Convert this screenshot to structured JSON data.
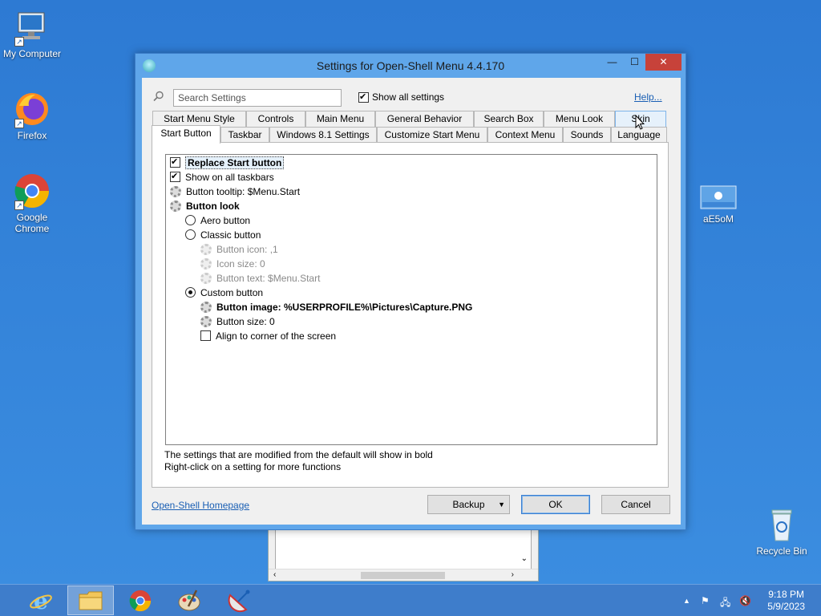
{
  "desktop": {
    "icons": [
      {
        "label": "My Computer"
      },
      {
        "label": "Firefox"
      },
      {
        "label": "Google Chrome"
      },
      {
        "label": "aE5oM"
      },
      {
        "label": "Recycle Bin"
      }
    ]
  },
  "window": {
    "title": "Settings for Open-Shell Menu 4.4.170",
    "search_placeholder": "Search Settings",
    "show_all_label": "Show all settings",
    "help_label": "Help...",
    "tabs_row1": [
      "Start Menu Style",
      "Controls",
      "Main Menu",
      "General Behavior",
      "Search Box",
      "Menu Look",
      "Skin"
    ],
    "tabs_row2": [
      "Start Button",
      "Taskbar",
      "Windows 8.1 Settings",
      "Customize Start Menu",
      "Context Menu",
      "Sounds",
      "Language"
    ],
    "active_tab": "Start Button",
    "settings": [
      {
        "label": "Replace Start button",
        "kind": "checkbox",
        "checked": true,
        "bold": true
      },
      {
        "label": "Show on all taskbars",
        "kind": "checkbox",
        "checked": true
      },
      {
        "label": "Button tooltip: $Menu.Start",
        "kind": "gear"
      },
      {
        "label": "Button look",
        "kind": "gear",
        "bold": true
      },
      {
        "label": "Aero button",
        "kind": "radio",
        "checked": false
      },
      {
        "label": "Classic button",
        "kind": "radio",
        "checked": false
      },
      {
        "label": "Button icon: ,1",
        "kind": "gear",
        "disabled": true
      },
      {
        "label": "Icon size: 0",
        "kind": "gear",
        "disabled": true
      },
      {
        "label": "Button text: $Menu.Start",
        "kind": "gear",
        "disabled": true
      },
      {
        "label": "Custom button",
        "kind": "radio",
        "checked": true
      },
      {
        "label": "Button image: %USERPROFILE%\\Pictures\\Capture.PNG",
        "kind": "gear",
        "bold": true
      },
      {
        "label": "Button size: 0",
        "kind": "gear"
      },
      {
        "label": "Align to corner of the screen",
        "kind": "checkbox",
        "checked": false
      }
    ],
    "footnote_line1": "The settings that are modified from the default will show in bold",
    "footnote_line2": "Right-click on a setting for more functions",
    "homepage_link": "Open-Shell Homepage",
    "buttons": {
      "backup": "Backup",
      "ok": "OK",
      "cancel": "Cancel"
    }
  },
  "taskbar": {
    "time": "9:18 PM",
    "date": "5/9/2023",
    "apps": [
      "internet-explorer",
      "file-explorer",
      "google-chrome",
      "paint",
      "network-tool"
    ]
  },
  "colors": {
    "desktop": "#2f7fd6",
    "close": "#c7423a",
    "link": "#1a5fb4"
  }
}
